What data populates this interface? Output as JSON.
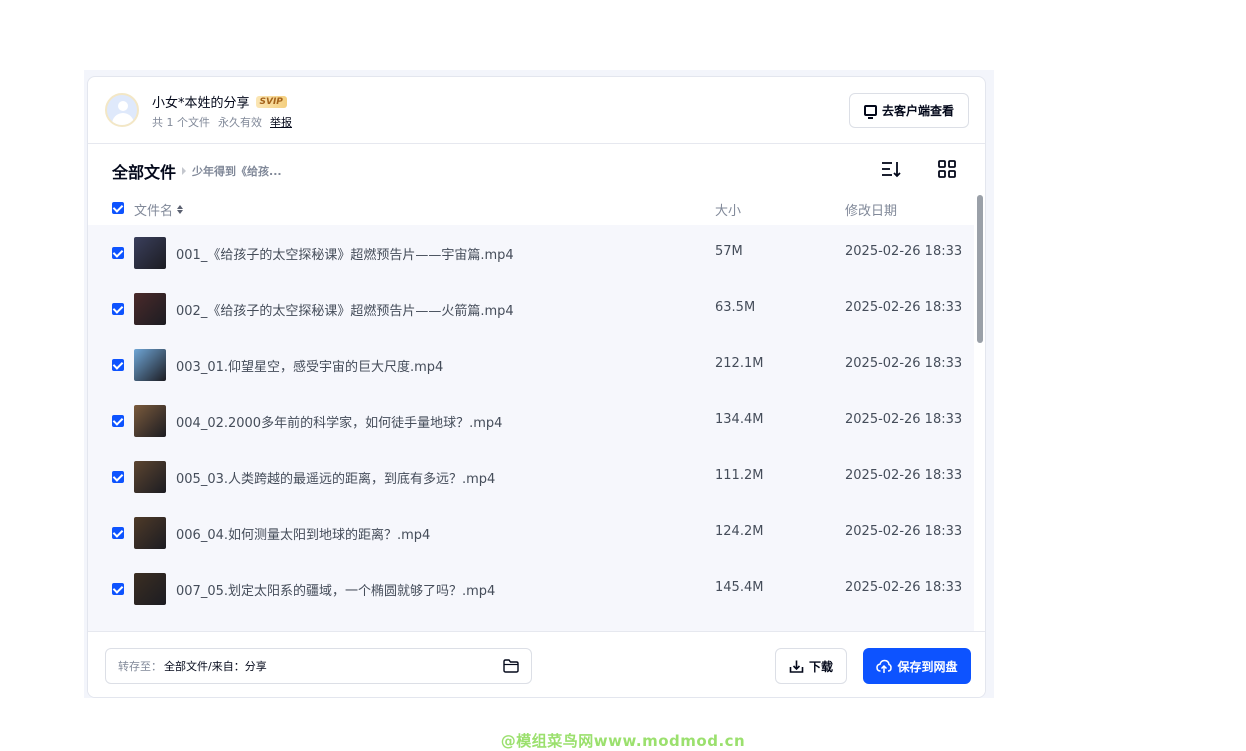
{
  "share": {
    "sharer": "小女*本姓的分享",
    "badge": "SVIP",
    "file_count": "共 1 个文件",
    "validity": "永久有效",
    "report": "举报",
    "client_button": "去客户端查看"
  },
  "breadcrumb": {
    "root": "全部文件",
    "current": "少年得到《给孩..."
  },
  "columns": {
    "name": "文件名",
    "size": "大小",
    "date": "修改日期"
  },
  "files": [
    {
      "name": "001_《给孩子的太空探秘课》超燃预告片——宇宙篇.mp4",
      "size": "57M",
      "date": "2025-02-26 18:33",
      "thumb": "#3a3f5c"
    },
    {
      "name": "002_《给孩子的太空探秘课》超燃预告片——火箭篇.mp4",
      "size": "63.5M",
      "date": "2025-02-26 18:33",
      "thumb": "#4a2a2a"
    },
    {
      "name": "003_01.仰望星空，感受宇宙的巨大尺度.mp4",
      "size": "212.1M",
      "date": "2025-02-26 18:33",
      "thumb": "#6fa6d6"
    },
    {
      "name": "004_02.2000多年前的科学家，如何徒手量地球？.mp4",
      "size": "134.4M",
      "date": "2025-02-26 18:33",
      "thumb": "#7a5a3c"
    },
    {
      "name": "005_03.人类跨越的最遥远的距离，到底有多远？.mp4",
      "size": "111.2M",
      "date": "2025-02-26 18:33",
      "thumb": "#5c4530"
    },
    {
      "name": "006_04.如何测量太阳到地球的距离？.mp4",
      "size": "124.2M",
      "date": "2025-02-26 18:33",
      "thumb": "#4e3a28"
    },
    {
      "name": "007_05.划定太阳系的疆域，一个椭圆就够了吗？.mp4",
      "size": "145.4M",
      "date": "2025-02-26 18:33",
      "thumb": "#3b2e22"
    }
  ],
  "footer": {
    "dest_label": "转存至：",
    "dest_value": "全部文件/来自：分享",
    "download": "下载",
    "save": "保存到网盘"
  },
  "watermark": "@模组菜鸟网www.modmod.cn",
  "colors": {
    "accent": "#0d53ff",
    "muted_text": "#818999",
    "list_bg": "#f6f7fc"
  }
}
